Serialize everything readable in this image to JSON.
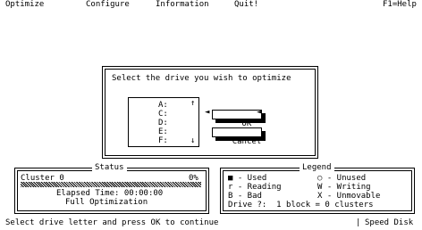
{
  "menu": {
    "optimize": "Optimize",
    "configure": "Configure",
    "information": "Information",
    "quit": "Quit!",
    "help": "F1=Help"
  },
  "dialog": {
    "title": "Select the drive you wish to optimize",
    "drives": [
      "A:",
      "C:",
      "D:",
      "E:",
      "F:"
    ],
    "ok_label": "OK",
    "cancel_label": "Cancel"
  },
  "status_panel": {
    "title": "Status",
    "cluster_label": "Cluster 0",
    "percent": "0%",
    "elapsed": "Elapsed Time: 00:00:00",
    "method": "Full Optimization",
    "progress": 0
  },
  "legend_panel": {
    "title": "Legend",
    "left_items": [
      "■ - Used",
      "r - Reading",
      "B - Bad"
    ],
    "right_items": [
      "○ - Unused",
      "W - Writing",
      "X - Unmovable"
    ],
    "drive_info": "Drive ?:  1 block = 0 clusters"
  },
  "status_bar": {
    "hint": "Select drive letter and press OK to continue",
    "app_name": "Speed Disk"
  }
}
